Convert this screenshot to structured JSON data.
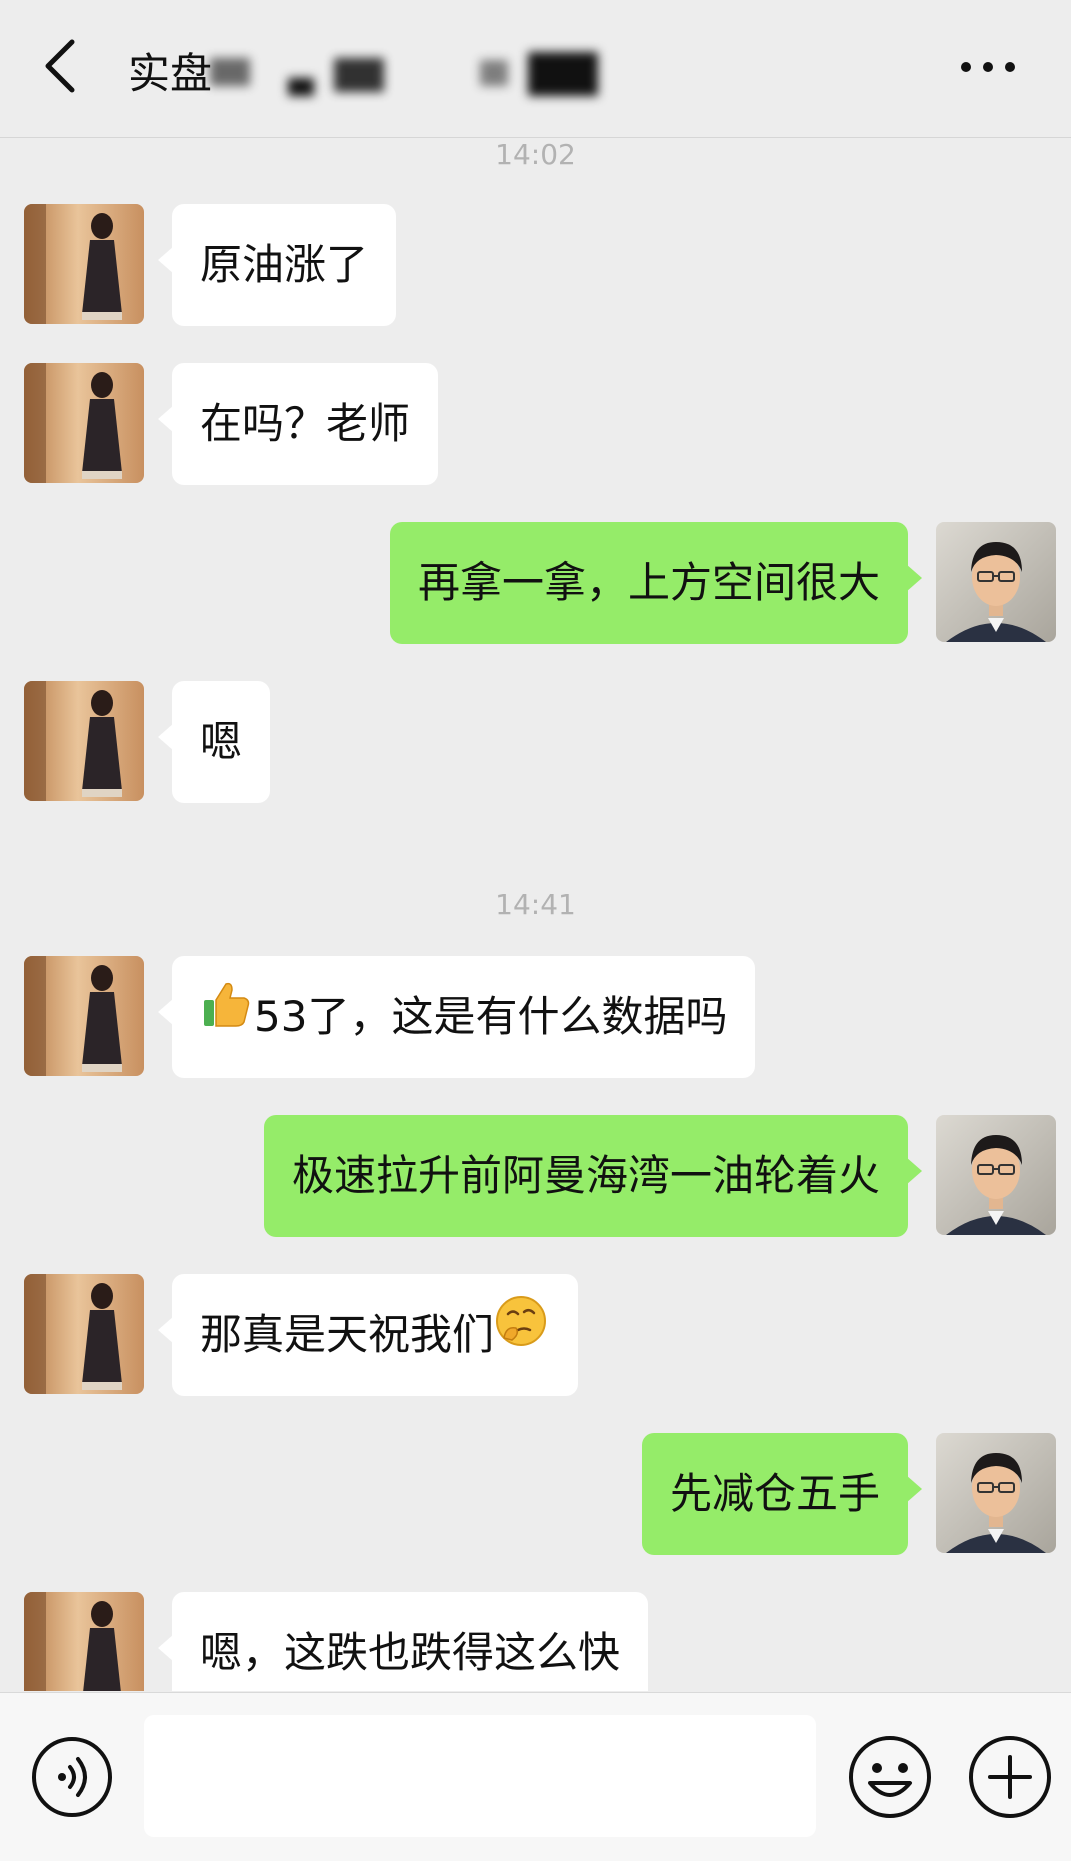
{
  "header": {
    "title": "实盘",
    "back_icon": "chevron-left-icon",
    "more_icon": "more-horizontal-icon"
  },
  "chat": {
    "time_1": "14:02",
    "time_2": "14:41",
    "messages": [
      {
        "from": "them",
        "text": "原油涨了"
      },
      {
        "from": "them",
        "text": "在吗？老师"
      },
      {
        "from": "me",
        "text": "再拿一拿，上方空间很大"
      },
      {
        "from": "them",
        "text": "嗯"
      },
      {
        "from": "them",
        "emoji": "thumbs-up-icon",
        "text": "53了，这是有什么数据吗"
      },
      {
        "from": "me",
        "text": "极速拉升前阿曼海湾一油轮着火"
      },
      {
        "from": "them",
        "text": "那真是天祝我们",
        "emoji_after": "thinking-face-icon"
      },
      {
        "from": "me",
        "text": "先减仓五手"
      },
      {
        "from": "them",
        "text": "嗯，这跌也跌得这么快"
      }
    ]
  },
  "input_bar": {
    "voice_icon": "voice-icon",
    "emoji_icon": "smiley-icon",
    "plus_icon": "plus-circle-icon",
    "input_value": ""
  },
  "colors": {
    "background": "#ededed",
    "incoming_bubble": "#ffffff",
    "outgoing_bubble": "#95ec69"
  }
}
